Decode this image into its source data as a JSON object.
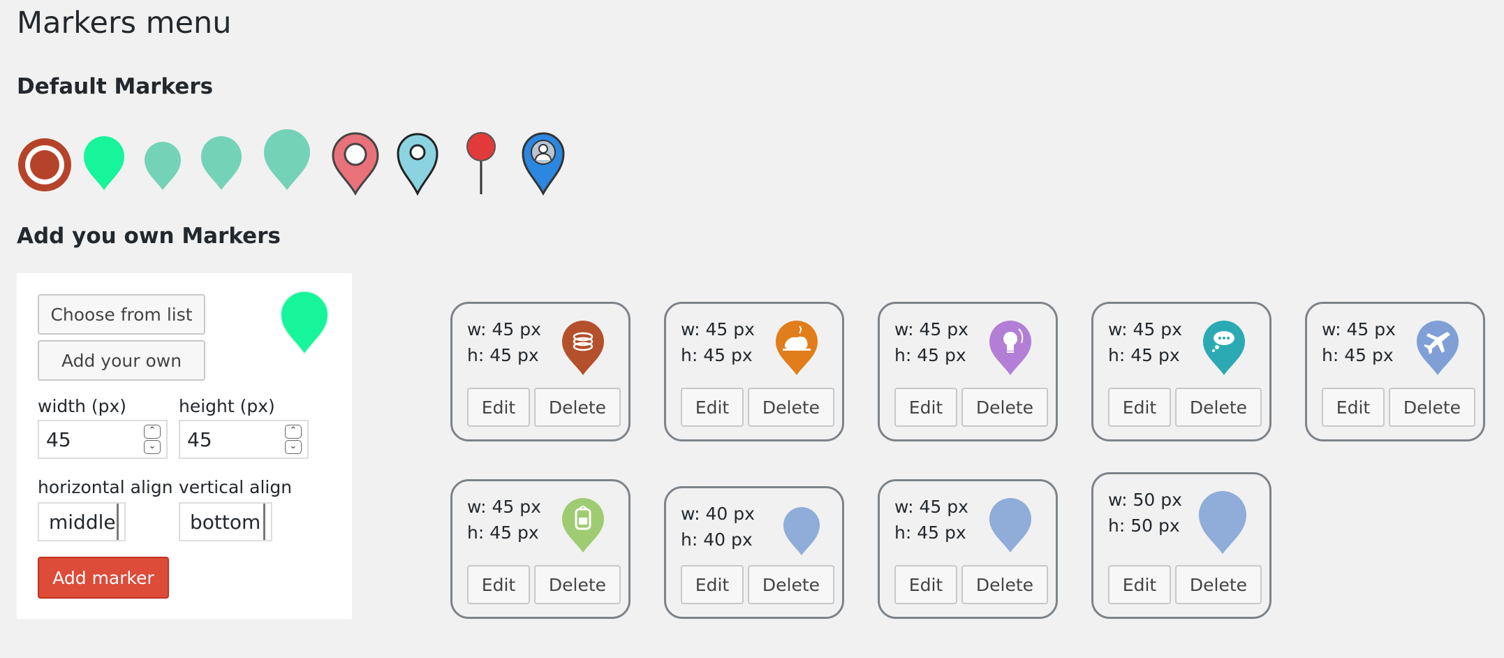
{
  "page_title": "Markers menu",
  "sections": {
    "default_title": "Default Markers",
    "add_title": "Add you own Markers"
  },
  "default_markers": [
    {
      "icon": "target-ring-marker-icon",
      "color": "#b5432a"
    },
    {
      "icon": "teardrop-marker-icon",
      "color": "#17f59a"
    },
    {
      "icon": "teardrop-marker-icon",
      "color": "#74d3b6"
    },
    {
      "icon": "teardrop-marker-icon",
      "color": "#74d3b6"
    },
    {
      "icon": "teardrop-marker-icon",
      "color": "#74d3b6"
    },
    {
      "icon": "map-pin-icon",
      "color": "#e8717a"
    },
    {
      "icon": "map-pin-icon",
      "color": "#8bd3e0"
    },
    {
      "icon": "push-pin-icon",
      "color": "#e23a3a"
    },
    {
      "icon": "person-pin-icon",
      "color": "#2b87e0"
    }
  ],
  "form": {
    "choose_label": "Choose from list",
    "add_own_label": "Add your own",
    "preview_color": "#17f59a",
    "width_label": "width (px)",
    "width_value": "45",
    "height_label": "height (px)",
    "height_value": "45",
    "halign_label": "horizontal align",
    "halign_value": "middle",
    "valign_label": "vertical align",
    "valign_value": "bottom",
    "add_marker_label": "Add marker",
    "accent_color": "#dd4b39"
  },
  "cards": [
    {
      "w": "w: 45 px",
      "h": "h: 45 px",
      "icon": "coins-icon",
      "color": "#b5502c",
      "edit": "Edit",
      "delete": "Delete"
    },
    {
      "w": "w: 45 px",
      "h": "h: 45 px",
      "icon": "turkey-icon",
      "color": "#e17d1a",
      "edit": "Edit",
      "delete": "Delete"
    },
    {
      "w": "w: 45 px",
      "h": "h: 45 px",
      "icon": "lightbulb-icon",
      "color": "#b37ed6",
      "edit": "Edit",
      "delete": "Delete"
    },
    {
      "w": "w: 45 px",
      "h": "h: 45 px",
      "icon": "chat-bubble-icon",
      "color": "#2baab3",
      "edit": "Edit",
      "delete": "Delete"
    },
    {
      "w": "w: 45 px",
      "h": "h: 45 px",
      "icon": "airplane-icon",
      "color": "#7f9fd6",
      "edit": "Edit",
      "delete": "Delete"
    },
    {
      "w": "w: 45 px",
      "h": "h: 45 px",
      "icon": "backpack-icon",
      "color": "#9fcc72",
      "edit": "Edit",
      "delete": "Delete"
    },
    {
      "w": "w: 40 px",
      "h": "h: 40 px",
      "icon": "teardrop-marker-icon",
      "color": "#8fadd8",
      "edit": "Edit",
      "delete": "Delete"
    },
    {
      "w": "w: 45 px",
      "h": "h: 45 px",
      "icon": "teardrop-marker-icon",
      "color": "#8fadd8",
      "edit": "Edit",
      "delete": "Delete"
    },
    {
      "w": "w: 50 px",
      "h": "h: 50 px",
      "icon": "teardrop-marker-icon",
      "color": "#8fadd8",
      "edit": "Edit",
      "delete": "Delete"
    }
  ]
}
